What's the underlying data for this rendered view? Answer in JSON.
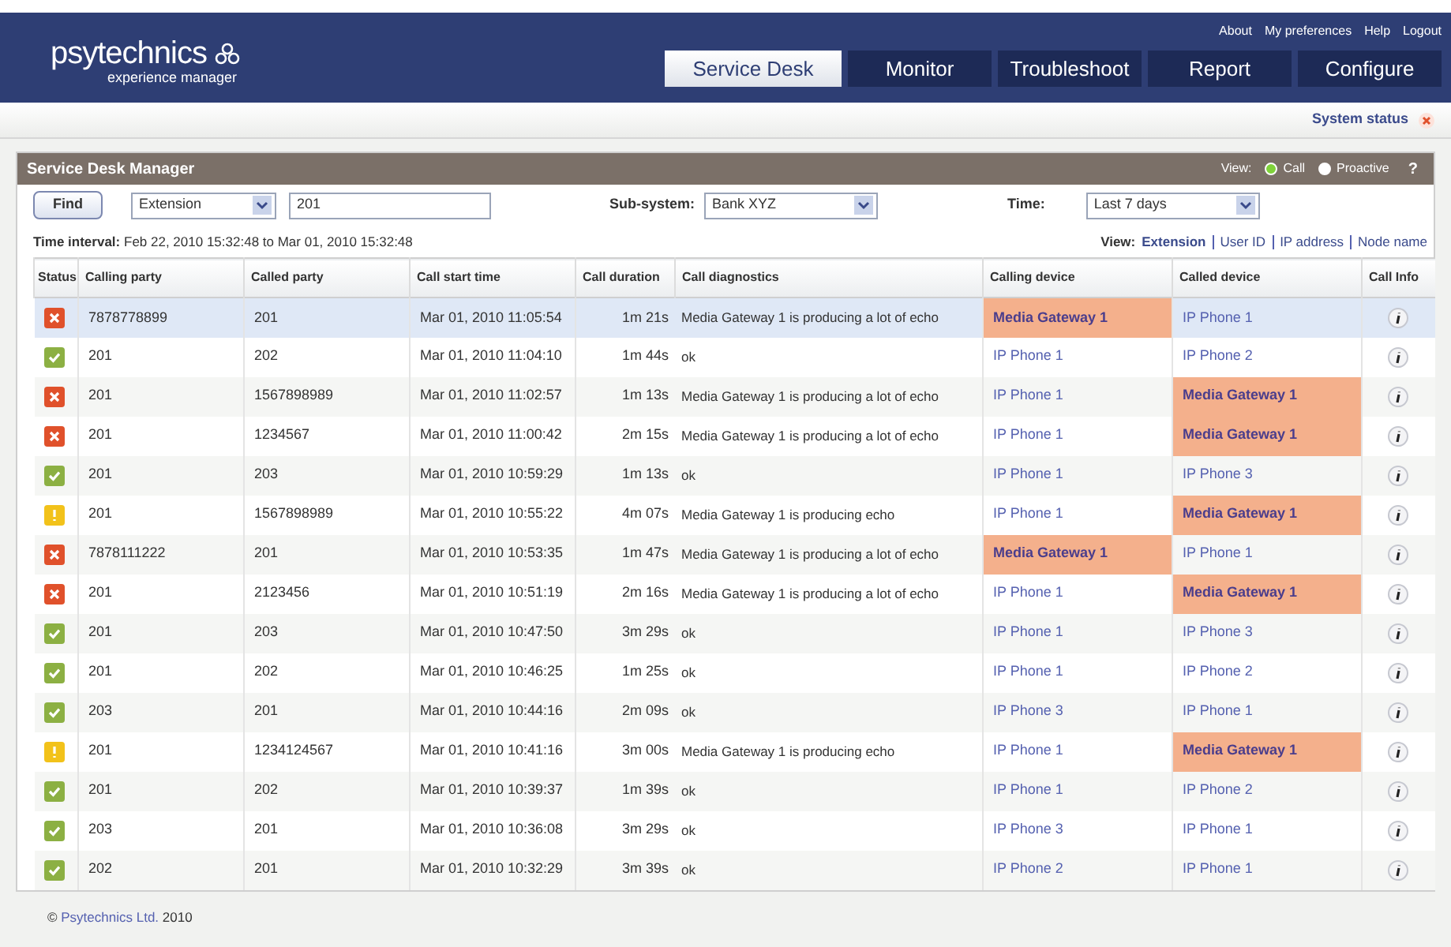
{
  "brand": {
    "name": "psytechnics",
    "tagline": "experience manager"
  },
  "top_links": [
    "About",
    "My preferences",
    "Help",
    "Logout"
  ],
  "tabs": [
    {
      "label": "Service Desk",
      "selected": true
    },
    {
      "label": "Monitor",
      "selected": false
    },
    {
      "label": "Troubleshoot",
      "selected": false
    },
    {
      "label": "Report",
      "selected": false
    },
    {
      "label": "Configure",
      "selected": false
    }
  ],
  "system_status": {
    "label": "System status"
  },
  "panel": {
    "title": "Service Desk Manager",
    "view_label": "View:",
    "view_options": [
      {
        "label": "Call",
        "selected": true
      },
      {
        "label": "Proactive",
        "selected": false
      }
    ],
    "help": "?"
  },
  "filters": {
    "find_button": "Find",
    "search_type": "Extension",
    "search_value": "201",
    "subsystem_label": "Sub-system:",
    "subsystem": "Bank XYZ",
    "time_label": "Time:",
    "time": "Last 7 days"
  },
  "interval": {
    "label": "Time interval:",
    "value": "Feb 22, 2010 15:32:48 to Mar 01, 2010 15:32:48"
  },
  "view_links": {
    "label": "View:",
    "options": [
      {
        "label": "Extension",
        "selected": true
      },
      {
        "label": "User ID",
        "selected": false
      },
      {
        "label": "IP address",
        "selected": false
      },
      {
        "label": "Node name",
        "selected": false
      }
    ]
  },
  "table": {
    "columns": [
      "Status",
      "Calling party",
      "Called party",
      "Call start time",
      "Call duration",
      "Call diagnostics",
      "Calling device",
      "Called device",
      "Call Info"
    ],
    "rows": [
      {
        "kind": "error",
        "selected": true,
        "calling": "7878778899",
        "called": "201",
        "start": "Mar 01, 2010 11:05:54",
        "duration": "1m 21s",
        "diagnostics": "Media Gateway 1 is producing a lot of echo",
        "calling_device": {
          "text": "Media Gateway 1",
          "fault": true
        },
        "called_device": {
          "text": "IP Phone 1",
          "fault": false
        }
      },
      {
        "kind": "ok",
        "selected": false,
        "calling": "201",
        "called": "202",
        "start": "Mar 01, 2010 11:04:10",
        "duration": "1m 44s",
        "diagnostics": "ok",
        "calling_device": {
          "text": "IP Phone 1",
          "fault": false
        },
        "called_device": {
          "text": "IP Phone 2",
          "fault": false
        }
      },
      {
        "kind": "error",
        "selected": false,
        "calling": "201",
        "called": "1567898989",
        "start": "Mar 01, 2010 11:02:57",
        "duration": "1m 13s",
        "diagnostics": "Media Gateway 1 is producing a lot of echo",
        "calling_device": {
          "text": "IP Phone 1",
          "fault": false
        },
        "called_device": {
          "text": "Media Gateway 1",
          "fault": true
        }
      },
      {
        "kind": "error",
        "selected": false,
        "calling": "201",
        "called": "1234567",
        "start": "Mar 01, 2010 11:00:42",
        "duration": "2m 15s",
        "diagnostics": "Media Gateway 1 is producing a lot of echo",
        "calling_device": {
          "text": "IP Phone 1",
          "fault": false
        },
        "called_device": {
          "text": "Media Gateway 1",
          "fault": true
        }
      },
      {
        "kind": "ok",
        "selected": false,
        "calling": "201",
        "called": "203",
        "start": "Mar 01, 2010 10:59:29",
        "duration": "1m 13s",
        "diagnostics": "ok",
        "calling_device": {
          "text": "IP Phone 1",
          "fault": false
        },
        "called_device": {
          "text": "IP Phone 3",
          "fault": false
        }
      },
      {
        "kind": "warning",
        "selected": false,
        "calling": "201",
        "called": "1567898989",
        "start": "Mar 01, 2010 10:55:22",
        "duration": "4m 07s",
        "diagnostics": "Media Gateway 1 is producing echo",
        "calling_device": {
          "text": "IP Phone 1",
          "fault": false
        },
        "called_device": {
          "text": "Media Gateway 1",
          "fault": true
        }
      },
      {
        "kind": "error",
        "selected": false,
        "calling": "7878111222",
        "called": "201",
        "start": "Mar 01, 2010 10:53:35",
        "duration": "1m 47s",
        "diagnostics": "Media Gateway 1 is producing a lot of echo",
        "calling_device": {
          "text": "Media Gateway 1",
          "fault": true
        },
        "called_device": {
          "text": "IP Phone 1",
          "fault": false
        }
      },
      {
        "kind": "error",
        "selected": false,
        "calling": "201",
        "called": "2123456",
        "start": "Mar 01, 2010 10:51:19",
        "duration": "2m 16s",
        "diagnostics": "Media Gateway 1 is producing a lot of echo",
        "calling_device": {
          "text": "IP Phone 1",
          "fault": false
        },
        "called_device": {
          "text": "Media Gateway 1",
          "fault": true
        }
      },
      {
        "kind": "ok",
        "selected": false,
        "calling": "201",
        "called": "203",
        "start": "Mar 01, 2010 10:47:50",
        "duration": "3m 29s",
        "diagnostics": "ok",
        "calling_device": {
          "text": "IP Phone 1",
          "fault": false
        },
        "called_device": {
          "text": "IP Phone 3",
          "fault": false
        }
      },
      {
        "kind": "ok",
        "selected": false,
        "calling": "201",
        "called": "202",
        "start": "Mar 01, 2010 10:46:25",
        "duration": "1m 25s",
        "diagnostics": "ok",
        "calling_device": {
          "text": "IP Phone 1",
          "fault": false
        },
        "called_device": {
          "text": "IP Phone 2",
          "fault": false
        }
      },
      {
        "kind": "ok",
        "selected": false,
        "calling": "203",
        "called": "201",
        "start": "Mar 01, 2010 10:44:16",
        "duration": "2m 09s",
        "diagnostics": "ok",
        "calling_device": {
          "text": "IP Phone 3",
          "fault": false
        },
        "called_device": {
          "text": "IP Phone 1",
          "fault": false
        }
      },
      {
        "kind": "warning",
        "selected": false,
        "calling": "201",
        "called": "1234124567",
        "start": "Mar 01, 2010 10:41:16",
        "duration": "3m 00s",
        "diagnostics": "Media Gateway 1 is producing echo",
        "calling_device": {
          "text": "IP Phone 1",
          "fault": false
        },
        "called_device": {
          "text": "Media Gateway 1",
          "fault": true
        }
      },
      {
        "kind": "ok",
        "selected": false,
        "calling": "201",
        "called": "202",
        "start": "Mar 01, 2010 10:39:37",
        "duration": "1m 39s",
        "diagnostics": "ok",
        "calling_device": {
          "text": "IP Phone 1",
          "fault": false
        },
        "called_device": {
          "text": "IP Phone 2",
          "fault": false
        }
      },
      {
        "kind": "ok",
        "selected": false,
        "calling": "203",
        "called": "201",
        "start": "Mar 01, 2010 10:36:08",
        "duration": "3m 29s",
        "diagnostics": "ok",
        "calling_device": {
          "text": "IP Phone 3",
          "fault": false
        },
        "called_device": {
          "text": "IP Phone 1",
          "fault": false
        }
      },
      {
        "kind": "ok",
        "selected": false,
        "calling": "202",
        "called": "201",
        "start": "Mar 01, 2010 10:32:29",
        "duration": "3m 39s",
        "diagnostics": "ok",
        "calling_device": {
          "text": "IP Phone 2",
          "fault": false
        },
        "called_device": {
          "text": "IP Phone 1",
          "fault": false
        }
      }
    ]
  },
  "footer": {
    "symbol": "©",
    "company": "Psytechnics Ltd.",
    "year": "2010"
  }
}
